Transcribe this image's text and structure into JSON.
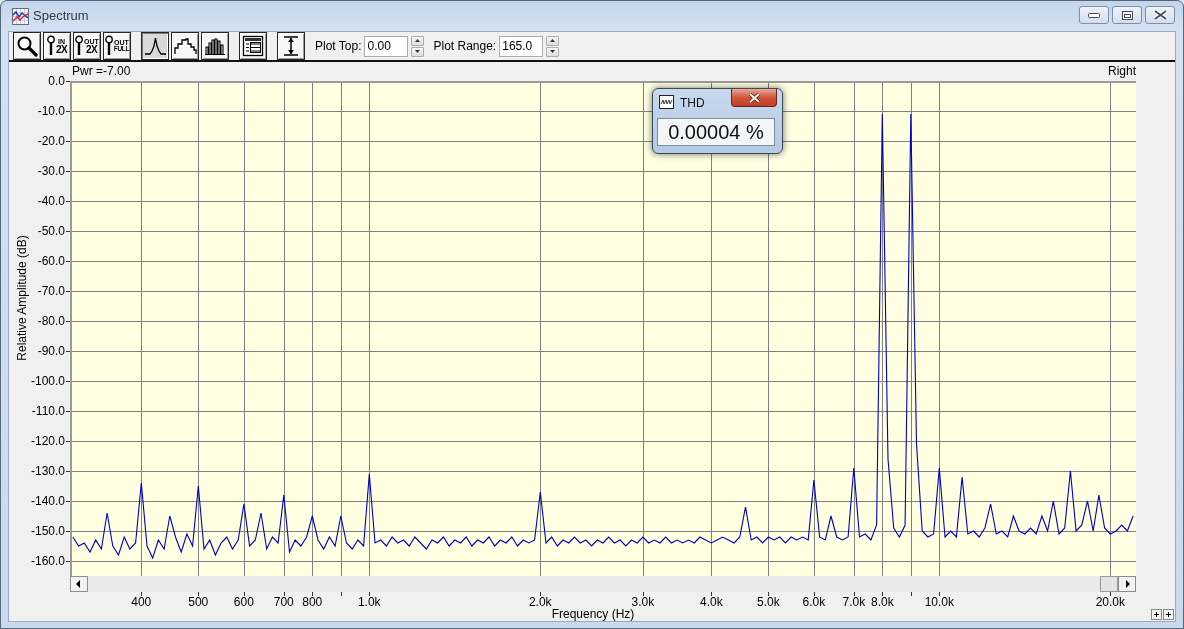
{
  "window": {
    "title": "Spectrum"
  },
  "toolbar": {
    "zoom_buttons": [
      {
        "kind": "magnify"
      },
      {
        "kind": "zoom",
        "top": "IN",
        "bottom": "2X"
      },
      {
        "kind": "zoom",
        "top": "OUT",
        "bottom": "2X"
      },
      {
        "kind": "zoom",
        "top": "OUT",
        "bottom": "FULL"
      }
    ],
    "view_buttons": [
      {
        "kind": "peak",
        "selected": true
      },
      {
        "kind": "step",
        "selected": false
      },
      {
        "kind": "bars",
        "selected": false
      }
    ],
    "tool_buttons": [
      {
        "kind": "panel"
      },
      {
        "kind": "range"
      }
    ],
    "fields": [
      {
        "label": "Plot Top:",
        "value": "0.00"
      },
      {
        "label": "Plot Range:",
        "value": "165.0"
      }
    ]
  },
  "chart": {
    "header_left": "Pwr =-7.00",
    "header_right": "Right",
    "chart_data": {
      "type": "line",
      "xlabel": "Frequency (Hz)",
      "ylabel": "Relative Amplitude (dB)",
      "ylim": [
        -165,
        0
      ],
      "grid": true,
      "categories": [
        null,
        null,
        null,
        null,
        null,
        null,
        null,
        null,
        null,
        null,
        null,
        null,
        "400",
        null,
        null,
        null,
        null,
        null,
        null,
        null,
        null,
        null,
        "500",
        null,
        null,
        null,
        null,
        null,
        null,
        null,
        "600",
        null,
        null,
        null,
        null,
        null,
        null,
        "700",
        null,
        null,
        null,
        null,
        "800",
        null,
        null,
        null,
        null,
        null,
        null,
        null,
        null,
        null,
        "1.0k",
        null,
        null,
        null,
        null,
        null,
        null,
        null,
        null,
        null,
        null,
        null,
        null,
        null,
        null,
        null,
        null,
        null,
        null,
        null,
        null,
        null,
        null,
        null,
        null,
        null,
        null,
        null,
        null,
        null,
        "2.0k",
        null,
        null,
        null,
        null,
        null,
        null,
        null,
        null,
        null,
        null,
        null,
        null,
        null,
        null,
        null,
        null,
        null,
        "3.0k",
        null,
        null,
        null,
        null,
        null,
        null,
        null,
        null,
        null,
        null,
        null,
        "4.0k",
        null,
        null,
        null,
        null,
        null,
        null,
        null,
        null,
        null,
        "5.0k",
        null,
        null,
        null,
        null,
        null,
        null,
        null,
        "6.0k",
        null,
        null,
        null,
        null,
        null,
        null,
        "7.0k",
        null,
        null,
        null,
        null,
        "8.0k",
        null,
        null,
        null,
        null,
        null,
        null,
        null,
        null,
        null,
        "10.0k",
        null,
        null,
        null,
        null,
        null,
        null,
        null,
        null,
        null,
        null,
        null,
        null,
        null,
        null,
        null,
        null,
        null,
        null,
        null,
        null,
        null,
        null,
        null,
        null,
        null,
        null,
        null,
        null,
        null,
        "20.0k",
        null,
        null,
        null,
        null
      ],
      "yticks": [
        {
          "value": 0,
          "label": "0.0"
        },
        {
          "value": -10,
          "label": "-10.0"
        },
        {
          "value": -20,
          "label": "-20.0"
        },
        {
          "value": -30,
          "label": "-30.0"
        },
        {
          "value": -40,
          "label": "-40.0"
        },
        {
          "value": -50,
          "label": "-50.0"
        },
        {
          "value": -60,
          "label": "-60.0"
        },
        {
          "value": -70,
          "label": "-70.0"
        },
        {
          "value": -80,
          "label": "-80.0"
        },
        {
          "value": -90,
          "label": "-90.0"
        },
        {
          "value": -100,
          "label": "-100.0"
        },
        {
          "value": -110,
          "label": "-110.0"
        },
        {
          "value": -120,
          "label": "-120.0"
        },
        {
          "value": -130,
          "label": "-130.0"
        },
        {
          "value": -140,
          "label": "-140.0"
        },
        {
          "value": -150,
          "label": "-150.0"
        },
        {
          "value": -160,
          "label": "-160.0"
        }
      ],
      "series": [
        {
          "color": "#0000c0",
          "values": [
            -152,
            -155,
            -154,
            -157,
            -153,
            -156,
            -144,
            -155,
            -158,
            -152,
            -156,
            -154,
            -134,
            -155,
            -159,
            -153,
            -156,
            -145,
            -152,
            -157,
            -151,
            -155,
            -135,
            -156,
            -153,
            -158,
            -154,
            -152,
            -156,
            -153,
            -141,
            -155,
            -153,
            -144,
            -156,
            -152,
            -154,
            -138,
            -157,
            -153,
            -155,
            -152,
            -145,
            -153,
            -156,
            -152,
            -155,
            -145,
            -154,
            -156,
            -153,
            -155,
            -131,
            -154,
            -153,
            -155,
            -152,
            -154,
            -153,
            -155,
            -152,
            -154,
            -156,
            -153,
            -154,
            -152,
            -155,
            -153,
            -154,
            -152,
            -155,
            -153,
            -154,
            -152,
            -155,
            -153,
            -154,
            -152,
            -155,
            -153,
            -154,
            -153,
            -137,
            -154,
            -152,
            -155,
            -153,
            -154,
            -152,
            -154,
            -153,
            -155,
            -153,
            -154,
            -152,
            -154,
            -153,
            -155,
            -153,
            -154,
            -152,
            -154,
            -153,
            -154,
            -152,
            -154,
            -153,
            -154,
            -153,
            -154,
            -152,
            -153,
            -154,
            -153,
            -152,
            -153,
            -154,
            -152,
            -142,
            -153,
            -152,
            -154,
            -152,
            -153,
            -152,
            -154,
            -152,
            -153,
            -152,
            -153,
            -133,
            -152,
            -153,
            -145,
            -152,
            -153,
            -152,
            -129,
            -152,
            -151,
            -153,
            -148,
            -11,
            -126,
            -149,
            -152,
            -148,
            -11,
            -121,
            -150,
            -152,
            -151,
            -129,
            -152,
            -150,
            -152,
            -132,
            -151,
            -150,
            -152,
            -149,
            -141,
            -151,
            -150,
            -152,
            -145,
            -150,
            -151,
            -149,
            -151,
            -145,
            -150,
            -140,
            -151,
            -149,
            -130,
            -150,
            -148,
            -140,
            -150,
            -138,
            -149,
            -151,
            -150,
            -148,
            -150,
            -145
          ]
        }
      ]
    }
  },
  "thd_window": {
    "title": "THD",
    "value": "0.00004 %"
  }
}
